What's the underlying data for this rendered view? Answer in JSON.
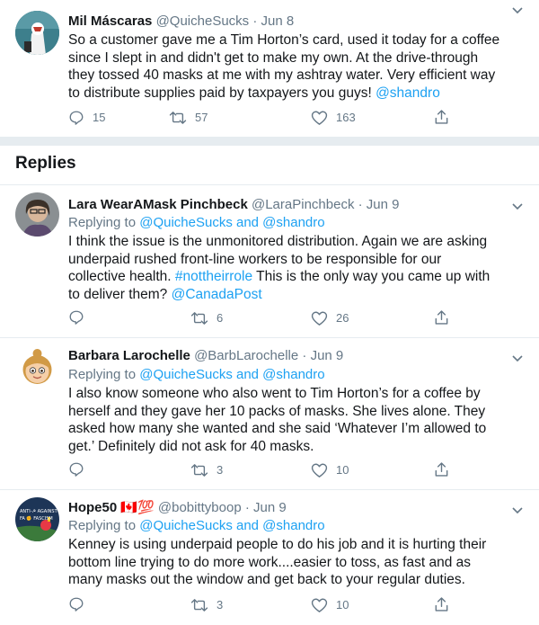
{
  "main_tweet": {
    "name": "Mil Máscaras",
    "handle": "@QuicheSucks",
    "dot": "·",
    "date": "Jun 8",
    "lines": [
      "So a customer gave me a Tim Horton’s card, used it today for a coffee",
      "since I slept in and didn't get to make my own. At the drive-through",
      "they tossed 40 masks at me with my ashtray water. Very efficient way",
      "to distribute supplies paid by taxpayers you guys!"
    ],
    "mention": "@shandro",
    "replies": "15",
    "retweets": "57",
    "likes": "163"
  },
  "replies_section": {
    "title": "Replies"
  },
  "replies": [
    {
      "name": "Lara WearAMask Pinchbeck",
      "handle": "@LaraPinchbeck",
      "dot": "·",
      "date": "Jun 9",
      "replying_prefix": "Replying to",
      "replying_to": "@QuicheSucks and @shandro",
      "lines": [
        "I think the issue is the unmonitored distribution. Again we are asking",
        "underpaid rushed front-line workers to be responsible for our",
        "collective health."
      ],
      "hashtag": "#nottheirrole",
      "line3_rest": "This is the only way you came up with",
      "line4": "to deliver them?",
      "mention": "@CanadaPost",
      "retweets": "6",
      "likes": "26"
    },
    {
      "name": "Barbara Larochelle",
      "handle": "@BarbLarochelle",
      "dot": "·",
      "date": "Jun 9",
      "replying_prefix": "Replying to",
      "replying_to": "@QuicheSucks and @shandro",
      "lines": [
        "I also know someone who also went to Tim Horton’s for a coffee by",
        "herself and they gave her 10 packs of masks. She lives alone. They",
        "asked how many she wanted and she said ‘Whatever I’m allowed to",
        "get.’ Definitely did not ask for 40 masks."
      ],
      "retweets": "3",
      "likes": "10"
    },
    {
      "name": "Hope50",
      "flags": "🇨🇦💯",
      "handle": "@bobittyboop",
      "dot": "·",
      "date": "Jun 9",
      "replying_prefix": "Replying to",
      "replying_to": "@QuicheSucks and @shandro",
      "lines": [
        "Kenney is using underpaid people to do his job and it is hurting their",
        "bottom line trying to do more work....easier to toss, as fast and as",
        "many masks out the window and get back to your regular duties."
      ],
      "avatar_text": [
        "ANTI-☭ AGAINST",
        "FA ✊ FASCISM"
      ],
      "retweets": "3",
      "likes": "10"
    }
  ],
  "icons": {
    "reply": "reply-icon",
    "retweet": "retweet-icon",
    "like": "heart-icon",
    "share": "share-icon",
    "more": "chevron-down-icon"
  },
  "colors": {
    "link": "#1da1f2",
    "muted": "#657786",
    "divider": "#e6ecf0"
  }
}
